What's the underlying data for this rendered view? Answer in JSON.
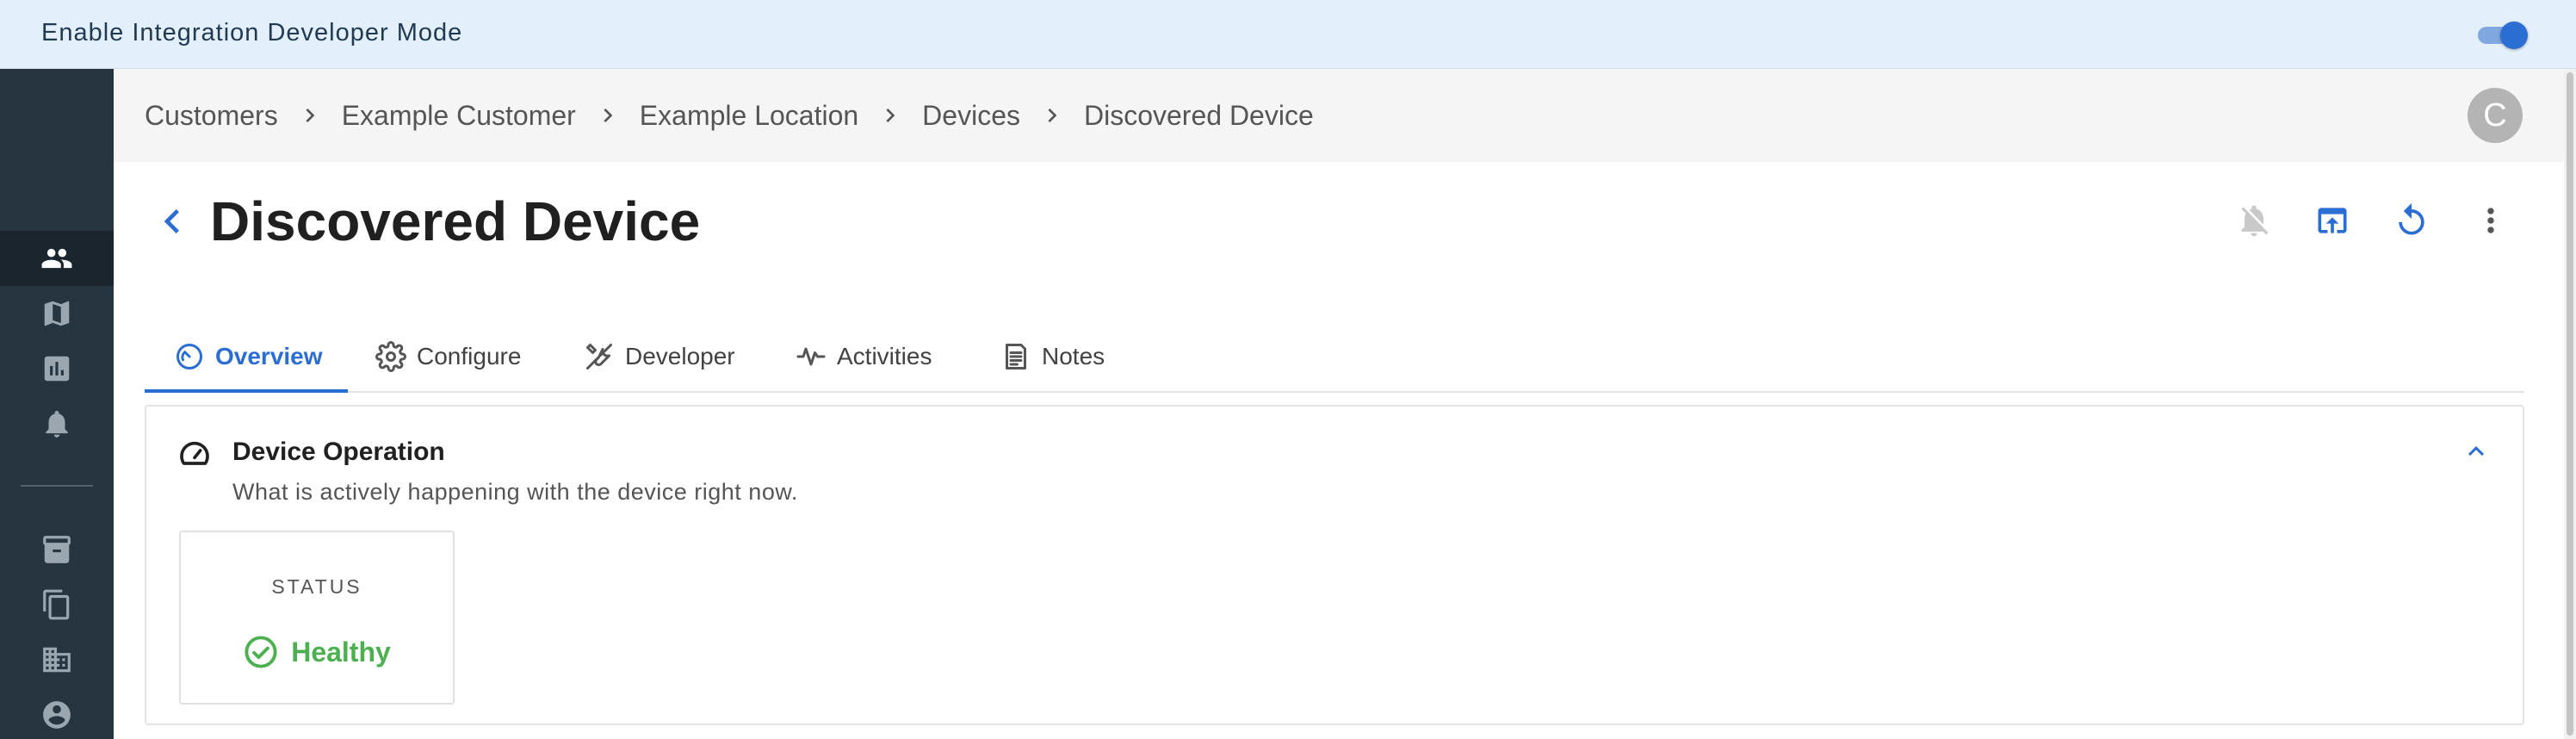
{
  "banner": {
    "label": "Enable Integration Developer Mode",
    "toggle_on": true
  },
  "nav_rail": {
    "items": [
      {
        "icon": "people-icon",
        "active": true
      },
      {
        "icon": "map-icon",
        "active": false
      },
      {
        "icon": "chart-icon",
        "active": false
      },
      {
        "icon": "bell-icon",
        "active": false
      },
      {
        "icon": "archive-icon",
        "active": false
      },
      {
        "icon": "copy-icon",
        "active": false
      },
      {
        "icon": "building-icon",
        "active": false
      },
      {
        "icon": "account-icon",
        "active": false
      }
    ]
  },
  "breadcrumb": {
    "items": [
      "Customers",
      "Example Customer",
      "Example Location",
      "Devices",
      "Discovered Device"
    ]
  },
  "user": {
    "avatar_initial": "C"
  },
  "page": {
    "title": "Discovered Device",
    "actions": [
      {
        "icon": "bell-off-icon",
        "enabled": false
      },
      {
        "icon": "open-in-browser-icon",
        "enabled": true
      },
      {
        "icon": "refresh-icon",
        "enabled": true
      },
      {
        "icon": "more-vert-icon",
        "enabled": true
      }
    ]
  },
  "tabs": [
    {
      "label": "Overview",
      "icon": "gauge-icon",
      "active": true
    },
    {
      "label": "Configure",
      "icon": "gear-icon",
      "active": false
    },
    {
      "label": "Developer",
      "icon": "tools-icon",
      "active": false
    },
    {
      "label": "Activities",
      "icon": "pulse-icon",
      "active": false
    },
    {
      "label": "Notes",
      "icon": "notes-icon",
      "active": false
    }
  ],
  "device_operation": {
    "title": "Device Operation",
    "subtitle": "What is actively happening with the device right now.",
    "expanded": true,
    "status": {
      "label": "STATUS",
      "value": "Healthy",
      "color": "#4caf50"
    }
  },
  "colors": {
    "accent": "#2a6ed3",
    "rail": "#263540",
    "banner": "#e3f0fb",
    "healthy": "#4caf50"
  }
}
